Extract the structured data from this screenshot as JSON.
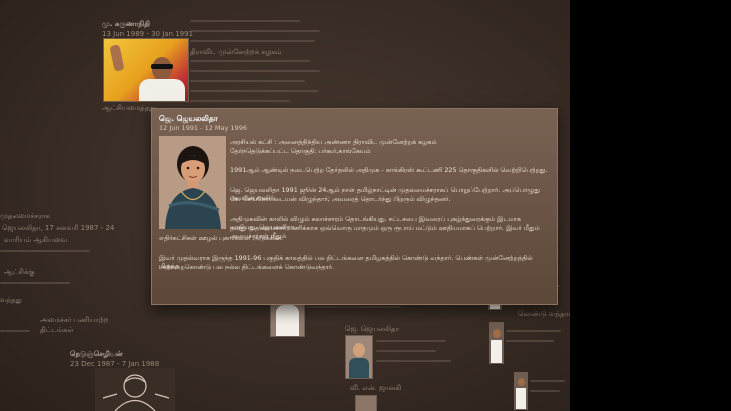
{
  "card": {
    "name": "ஜெ. ஜெயலலிதா",
    "dates": "12 Jun 1991 - 12 May 1996",
    "paragraphs": [
      "அரசியல் கட்சி : அனைத்திந்திய அண்ணா திராவிட முன்னேற்றக் கழகம்",
      "தேர்ந்தெடுக்கப்பட்ட தொகுதி: பர்கூர்,காங்கேயம்",
      "1991ஆம் ஆண்டில் நடைபெற்ற தேர்தலில் அதிமுக - காங்கிரஸ் கூட்டணி 225 தொகுதிகளில் வெற்றிபெற்றது.",
      "ஜெ. ஜெயலலிதா 1991 ஜூன் 24ஆம் நாள் தமிழ்நாட்டின் முதலமைச்சராகப் பொறுப்பேற்றார். அப்பொழுது அவரின் காலில்",
      "கே. செங்கோட்டையன் விழுந்தார்; அவரைத் தொடர்ந்து பிறரும் விழுந்தனர்.",
      "அதிமுகவின் காலில் விழும் கலாச்சாரம் தொடங்கியது. சட்டசபை இவரைப் புகழ்ந்துரைக்கும் இடமாக மாறியது. ஜெயலலிதா",
      "தனது முதலமைச்சர் பணிக்காக ஒவ்வொரு மாதமும் ஒரு ரூபாய் மட்டும் ஊதியமாகப் பெற்றார். இவர் மீதும் அமைச்சர்கள் மீதும்",
      "எதிர்கட்சிகள் ஊழல் புகார்களை அடுக்கின.",
      "இவர் முதல்வராக இருந்த 1991-96 பகுதிக் காலத்தில் பல திட்டங்களை தமிழகத்தில் கொண்டு வந்தார். பெண்கள் முன்னேற்றத்தில் மிகுந்த",
      "அக்கறைகொண்டு பல நல்ல திட்டங்களைக் கொண்டுவந்தார்."
    ]
  },
  "background": {
    "texts": [
      "மு. கருணாநிதி",
      "13 Jun 1989 - 30 Jan 1991",
      "திராவிட முன்னேற்றக் கழகம்",
      "ஆட்சியமைத்தது",
      "முதலமைச்சராக",
      "ஜெயலலிதா, 17 சனவரி 1987 - 24",
      "வாரியம் ஆகியவை",
      "ஆட்சிக்கு",
      "வந்தது",
      "அமைச்சர் பணியாற்ற",
      "திட்டங்கள்",
      "நெடுஞ்செழியன்",
      "23 Dec 1987 - 7 Jan 1988",
      "வி. என். ஜானகி",
      "ஜெ. ஜெயலலிதா",
      "கொண்டு வந்தார்"
    ]
  }
}
